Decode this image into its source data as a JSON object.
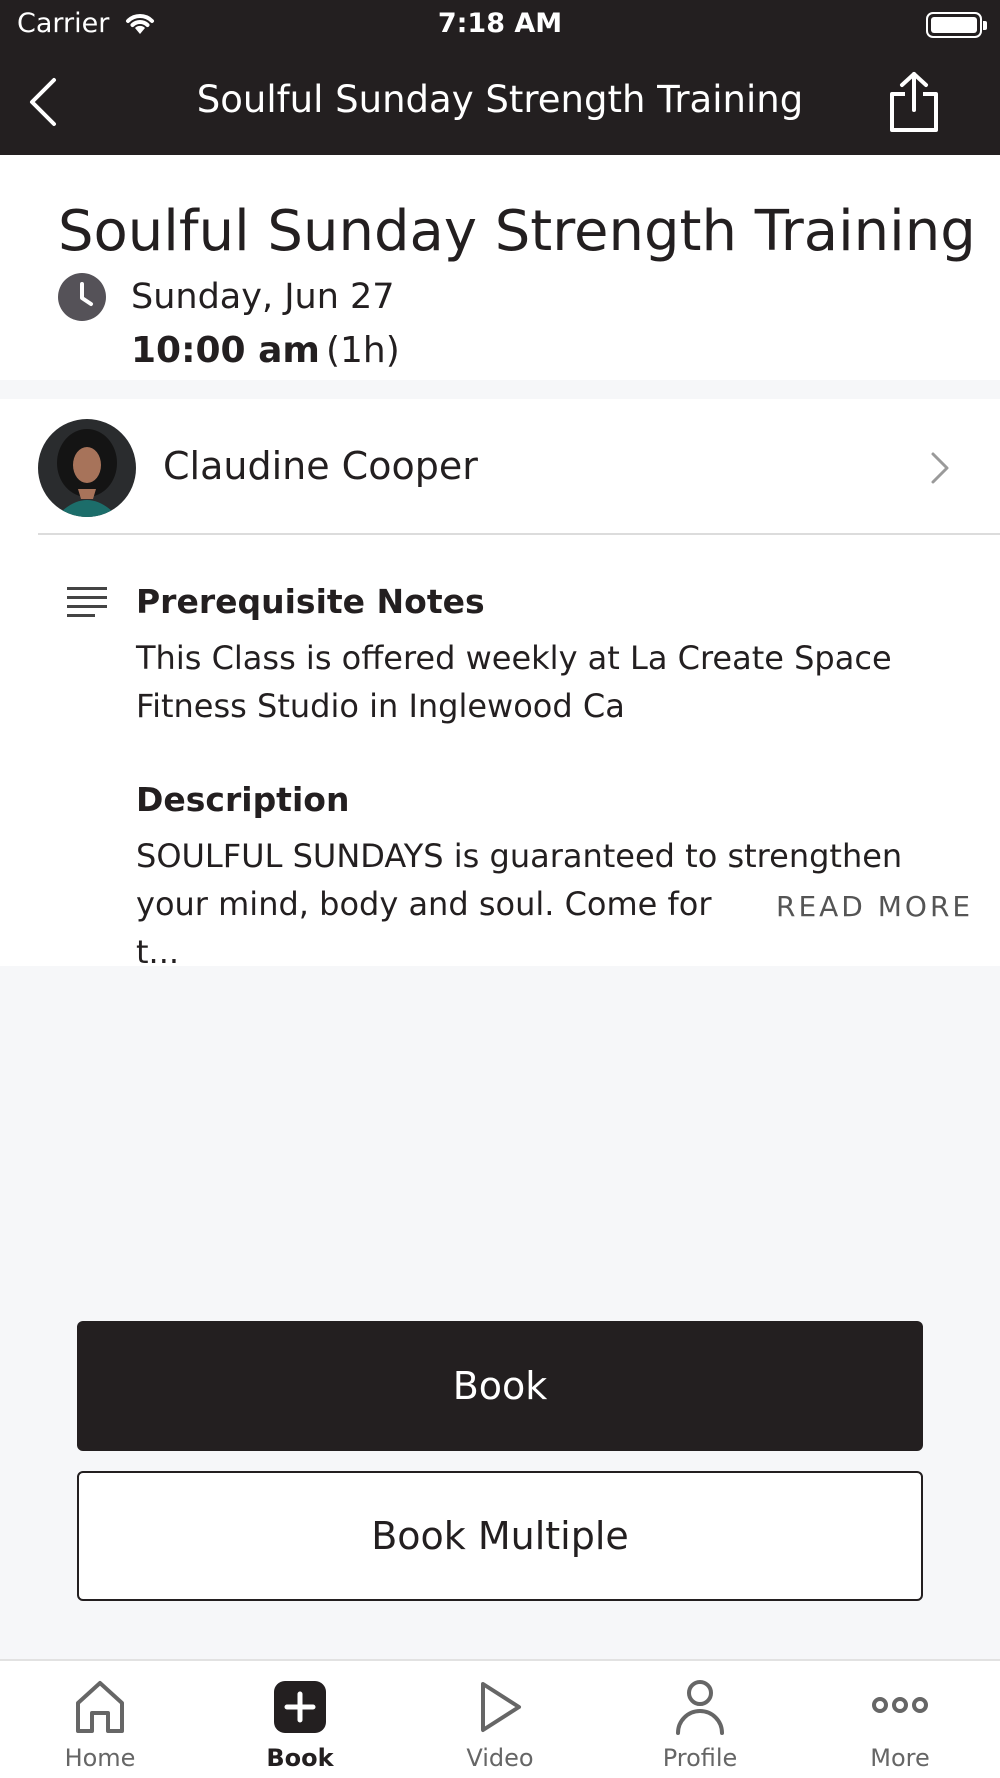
{
  "status_bar": {
    "carrier": "Carrier",
    "time": "7:18 AM"
  },
  "nav": {
    "title": "Soulful Sunday Strength Training",
    "back_icon": "chevron-left-icon",
    "share_icon": "share-icon"
  },
  "class_info": {
    "title": "Soulful Sunday Strength Training",
    "date": "Sunday, Jun 27",
    "start_time": "10:00 am",
    "duration": "(1h)"
  },
  "instructor": {
    "name": "Claudine Cooper"
  },
  "prerequisite": {
    "heading": "Prerequisite Notes",
    "body": "This Class is offered weekly at La Create Space Fitness Studio in Inglewood Ca"
  },
  "description": {
    "heading": "Description",
    "body_line1": "SOULFUL SUNDAYS is guaranteed to strengthen",
    "body_line2": "your mind, body and soul. Come for t...",
    "read_more": "READ MORE"
  },
  "actions": {
    "book_label": "Book",
    "book_multiple_label": "Book Multiple"
  },
  "tabbar": {
    "items": [
      {
        "label": "Home",
        "icon": "home-icon",
        "active": false
      },
      {
        "label": "Book",
        "icon": "plus-square-icon",
        "active": true
      },
      {
        "label": "Video",
        "icon": "play-icon",
        "active": false
      },
      {
        "label": "Profile",
        "icon": "person-icon",
        "active": false
      },
      {
        "label": "More",
        "icon": "more-dots-icon",
        "active": false
      }
    ]
  },
  "colors": {
    "brand_dark": "#231f20",
    "background": "#f6f7f9"
  }
}
